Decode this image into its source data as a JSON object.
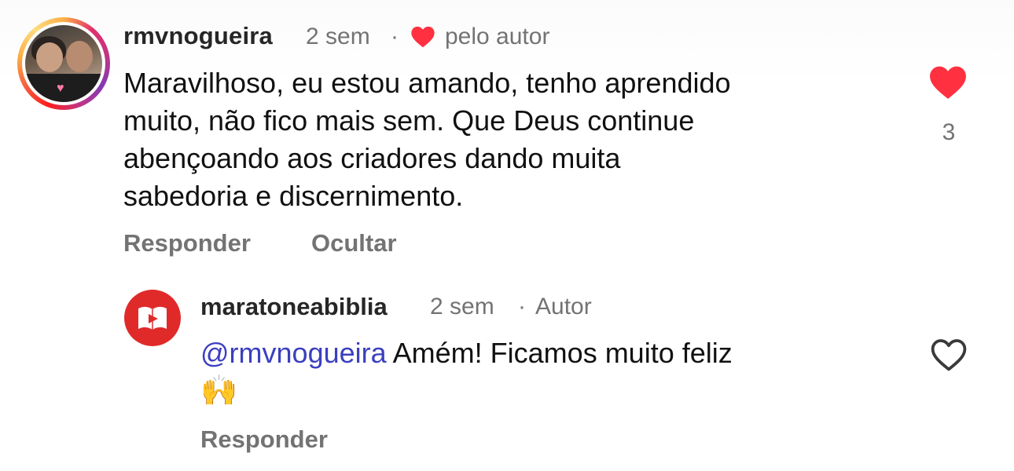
{
  "comment": {
    "username": "rmvnogueira",
    "time": "2 sem",
    "separator": "·",
    "liked_by_author_label": "pelo autor",
    "text": "Maravilhoso, eu estou amando, tenho aprendido\nmuito, não fico mais sem. Que Deus continue\nabençoando aos criadores dando muita\nsabedoria e discernimento.",
    "reply_label": "Responder",
    "hide_label": "Ocultar",
    "like_count": "3",
    "liked": true
  },
  "reply": {
    "username": "maratoneabiblia",
    "time": "2 sem",
    "separator": "·",
    "badge": "Autor",
    "mention": "@rmvnogueira",
    "text": " Amém! Ficamos muito feliz",
    "emoji": "🙌",
    "reply_label": "Responder",
    "liked": false
  },
  "colors": {
    "like_red": "#ff3040",
    "muted_text": "#737373",
    "mention_blue": "#3b3fbf",
    "brand_red": "#e02a2a"
  },
  "icons": {
    "liked_heart": "heart-filled-icon",
    "author_heart": "heart-small-filled-icon",
    "unliked_heart": "heart-outline-icon",
    "brand_logo": "book-play-logo"
  }
}
